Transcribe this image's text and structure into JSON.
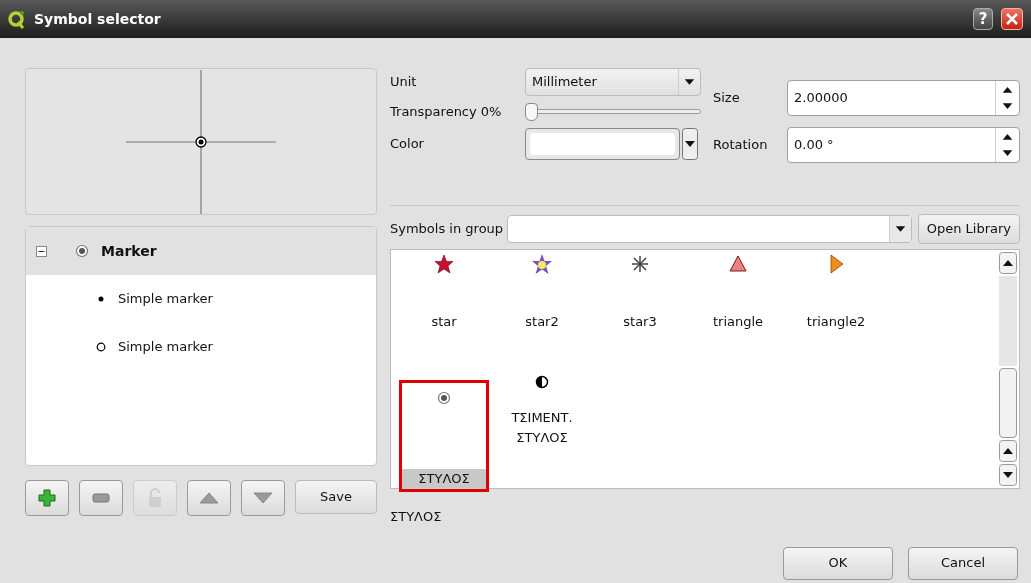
{
  "window": {
    "title": "Symbol selector",
    "help": "?"
  },
  "layers": {
    "label": "Marker",
    "expanded": true,
    "selected": true,
    "children": [
      {
        "label": "Simple marker",
        "kind": "dot"
      },
      {
        "label": "Simple marker",
        "kind": "ring"
      }
    ]
  },
  "layer_buttons": [
    {
      "kind": "add",
      "disabled": false
    },
    {
      "kind": "remove",
      "disabled": false
    },
    {
      "kind": "lock",
      "disabled": true
    },
    {
      "kind": "up",
      "disabled": false
    },
    {
      "kind": "down",
      "disabled": false
    }
  ],
  "save_button": "Save",
  "unit": {
    "label": "Unit",
    "value": "Millimeter"
  },
  "transparency": {
    "label": "Transparency 0%",
    "level": 0
  },
  "color": {
    "label": "Color",
    "color": "#ffffff"
  },
  "size": {
    "label": "Size",
    "value": "2.00000"
  },
  "rotation": {
    "label": "Rotation",
    "value": "0.00 °"
  },
  "group": {
    "label": "Symbols in group",
    "button": "Open Library"
  },
  "symbols": [
    {
      "name": "star",
      "kind": "star",
      "selected": false
    },
    {
      "name": "star2",
      "kind": "star2",
      "selected": false
    },
    {
      "name": "star3",
      "kind": "star3",
      "selected": false
    },
    {
      "name": "triangle",
      "kind": "triangle",
      "selected": false
    },
    {
      "name": "triangle2",
      "kind": "triangle2",
      "selected": false
    },
    {
      "name": "ΣΤΥΛΟΣ",
      "kind": "target",
      "selected": true
    },
    {
      "name": "ΤΣΙΜΕΝΤ. ΣΤΥΛΟΣ",
      "kind": "halfcircle",
      "selected": false
    }
  ],
  "selected_name": "ΣΤΥΛΟΣ",
  "buttons": [
    "OK",
    "Cancel"
  ]
}
